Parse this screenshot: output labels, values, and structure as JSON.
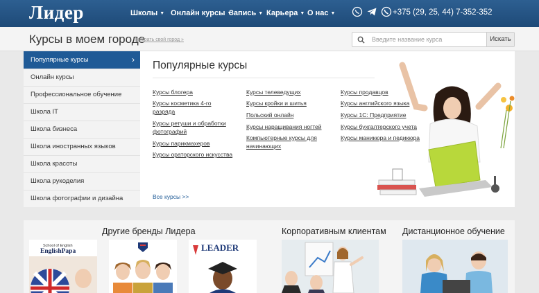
{
  "header": {
    "logo": "Лидер",
    "nav": [
      {
        "label": "Школы"
      },
      {
        "label": "Онлайн курсы"
      },
      {
        "label": "Запись"
      },
      {
        "label": "Карьера"
      },
      {
        "label": "О нас"
      }
    ],
    "phone": "+375 (29, 25, 44) 7-352-352",
    "social_icons": [
      "viber-icon",
      "telegram-icon",
      "phone-icon"
    ]
  },
  "subheader": {
    "title": "Курсы в моем городе",
    "city_link": "выбрать свой город »",
    "search_placeholder": "Введите название курса",
    "search_button": "Искать"
  },
  "sidebar": {
    "items": [
      {
        "label": "Популярные курсы",
        "active": true
      },
      {
        "label": "Онлайн курсы"
      },
      {
        "label": "Профессиональное обучение"
      },
      {
        "label": "Школа IT"
      },
      {
        "label": "Школа бизнеса"
      },
      {
        "label": "Школа иностранных языков"
      },
      {
        "label": "Школа красоты"
      },
      {
        "label": "Школа рукоделия"
      },
      {
        "label": "Школа фотографии и дизайна"
      }
    ]
  },
  "main": {
    "title": "Популярные курсы",
    "columns": [
      [
        "Курсы блогера",
        "Курсы косметика 4-го разряда",
        "Курсы ретуши и обработки фотографий",
        "Курсы парикмахеров",
        "Курсы ораторского искусства"
      ],
      [
        "Курсы телеведущих",
        "Курсы кройки и шитья",
        "Польский онлайн",
        "Курсы наращивания ногтей",
        "Компьютерные курсы для начинающих"
      ],
      [
        "Курсы продавцов",
        "Курсы английского языка",
        "Курсы 1С: Предприятие",
        "Курсы бухгалтерского учета",
        "Курсы маникюра и педикюра"
      ]
    ],
    "all_courses": "Все курсы >>"
  },
  "bottom": {
    "brands_title": "Другие бренды Лидера",
    "brand_logos": [
      "School of English",
      "EnglishPapa",
      "LEADER"
    ],
    "corporate_title": "Корпоративным клиентам",
    "distance_title": "Дистанционное обучение"
  },
  "colors": {
    "header_bg": "#1e4a78",
    "active_item": "#1f5a96",
    "page_bg": "#e9e9e9"
  }
}
